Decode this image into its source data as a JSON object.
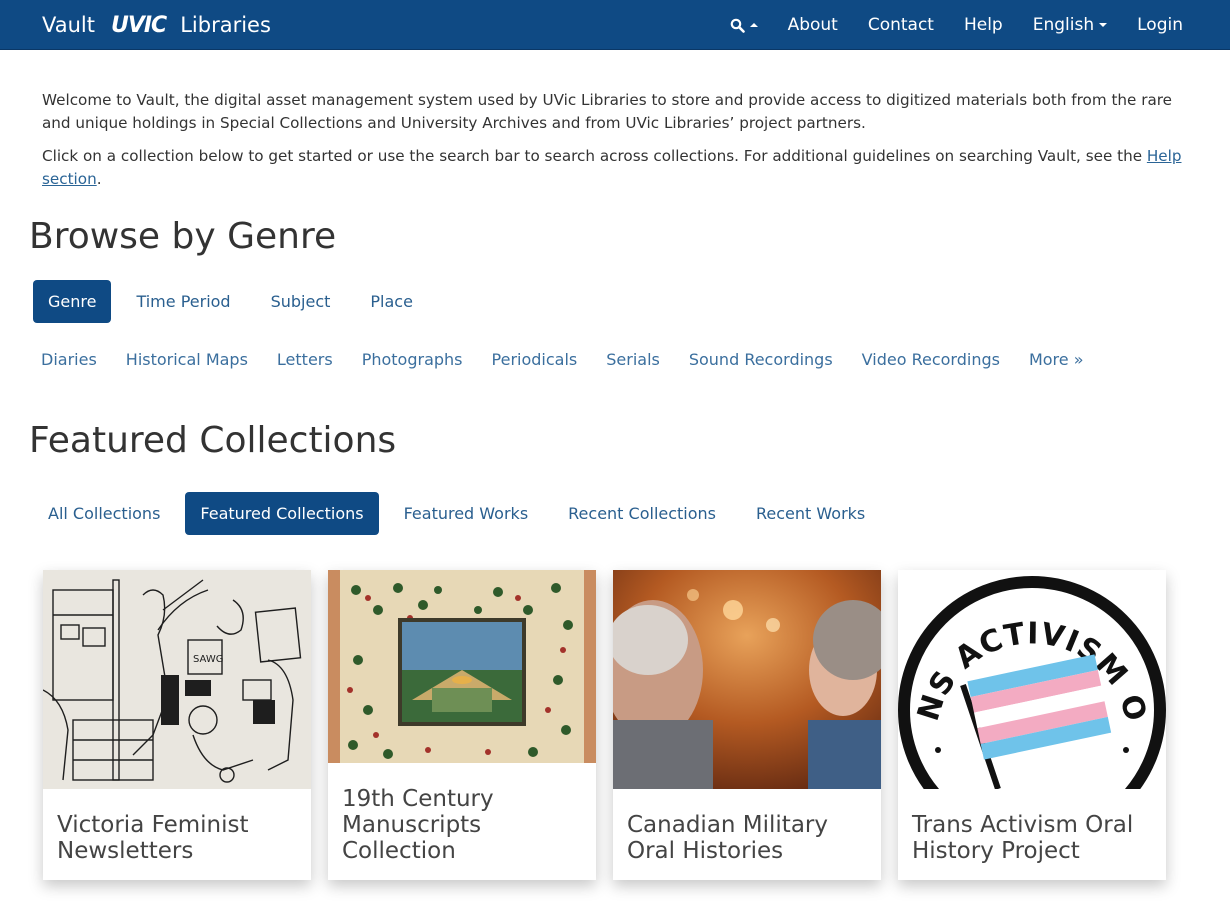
{
  "navbar": {
    "brand_left": "Vault",
    "brand_logo": "UVIC",
    "brand_right": "Libraries",
    "search_icon": "search-icon",
    "links": [
      "About",
      "Contact",
      "Help",
      "English",
      "Login"
    ]
  },
  "intro": {
    "paragraph1": "Welcome to Vault, the digital asset management system used by UVic Libraries to store and provide access to digitized materials both from the rare and unique holdings in Special Collections and University Archives and from UVic Libraries’ project partners.",
    "paragraph2_prefix": "Click on a collection below to get started or use the search bar to search across collections. For additional guidelines on searching Vault, see the ",
    "paragraph2_link": "Help section",
    "paragraph2_suffix": "."
  },
  "browse": {
    "title": "Browse by Genre",
    "tabs": [
      "Genre",
      "Time Period",
      "Subject",
      "Place"
    ],
    "active_tab": "Genre",
    "genres": [
      "Diaries",
      "Historical Maps",
      "Letters",
      "Photographs",
      "Periodicals",
      "Serials",
      "Sound Recordings",
      "Video Recordings",
      "More »"
    ]
  },
  "featured": {
    "title": "Featured Collections",
    "tabs": [
      "All Collections",
      "Featured Collections",
      "Featured Works",
      "Recent Collections",
      "Recent Works"
    ],
    "active_tab": "Featured Collections",
    "cards": [
      {
        "title": "Victoria Feminist Newsletters"
      },
      {
        "title": "19th Century Manuscripts Collection"
      },
      {
        "title": "Canadian Military Oral Histories"
      },
      {
        "title": "Trans Activism Oral History Project",
        "image_text": "TRANS ACTIVISM ORAL"
      }
    ]
  },
  "colors": {
    "navbar": "#0f4a84",
    "link": "#3b6f9e",
    "active_pill": "#0f4a84"
  }
}
